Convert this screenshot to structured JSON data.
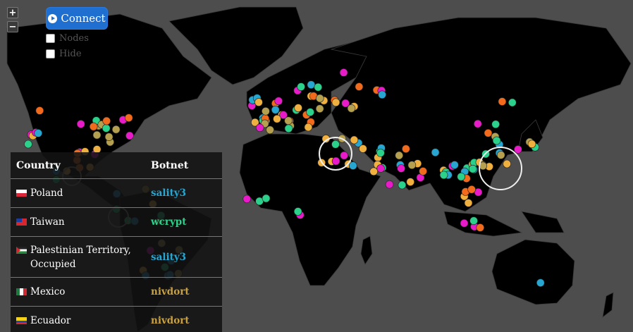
{
  "controls": {
    "zoom_in": "+",
    "zoom_out": "−",
    "connect_label": "Connect"
  },
  "options": [
    {
      "label": "Nodes",
      "checked": false
    },
    {
      "label": "Hide",
      "checked": false
    }
  ],
  "table": {
    "headers": {
      "country": "Country",
      "botnet": "Botnet"
    },
    "rows": [
      {
        "country": "Poland",
        "botnet": "sality3",
        "color": "#26a6d1",
        "flag": "poland"
      },
      {
        "country": "Taiwan",
        "botnet": "wcrypt",
        "color": "#2bd18b",
        "flag": "taiwan"
      },
      {
        "country": "Palestinian Territory, Occupied",
        "botnet": "sality3",
        "color": "#26a6d1",
        "flag": "palestine"
      },
      {
        "country": "Mexico",
        "botnet": "nivdort",
        "color": "#c8a040",
        "flag": "mexico"
      },
      {
        "country": "Ecuador",
        "botnet": "nivdort",
        "color": "#c8a040",
        "flag": "ecuador"
      }
    ]
  },
  "colors": {
    "background": "#4d4d4d",
    "land": "#000000",
    "sality3": "#26a6d1",
    "wcrypt": "#2bd18b",
    "nivdort": "#c8a040",
    "orange": "#f26b1d",
    "magenta": "#e81bc8",
    "gold": "#f0b040",
    "olive": "#b5a050"
  }
}
